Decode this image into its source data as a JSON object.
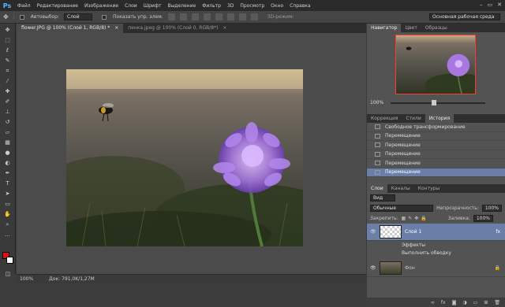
{
  "menu": {
    "logo": "Ps",
    "items": [
      "Файл",
      "Редактирование",
      "Изображение",
      "Слои",
      "Шрифт",
      "Выделение",
      "Фильтр",
      "3D",
      "Просмотр",
      "Окно",
      "Справка"
    ],
    "window_controls": [
      "–",
      "▭",
      "✕"
    ]
  },
  "options": {
    "autoselect_label": "Автовыбор:",
    "autoselect_value": "Слой",
    "show_transform_label": "Показать упр. элем.",
    "mode_3d": "3D-режим:",
    "workspace": "Основная рабочая среда"
  },
  "tabs": [
    {
      "label": "flower.JPG @ 100% (Слой 1, RGB/8) *",
      "close": "×"
    },
    {
      "label": "пенка.jpeg @ 100% (Слой 0, RGB/8*)",
      "close": "×"
    }
  ],
  "status": {
    "zoom": "100%",
    "doc": "Док: 791,0K/1,27M"
  },
  "navigator": {
    "tabs": [
      "Навигатор",
      "Цвет",
      "Образцы"
    ],
    "zoom": "100%"
  },
  "history": {
    "tabs": [
      "Коррекция",
      "Стили",
      "История"
    ],
    "rows": [
      "Свободное трансформирование",
      "Перемещение",
      "Перемещение",
      "Перемещение",
      "Перемещение",
      "Перемещение"
    ]
  },
  "layers": {
    "tabs": [
      "Слои",
      "Каналы",
      "Контуры"
    ],
    "kind": "Вид",
    "blend": "Обычные",
    "opacity_label": "Непрозрачность:",
    "opacity_value": "100%",
    "lock_label": "Закрепить:",
    "fill_label": "Заливка:",
    "fill_value": "100%",
    "items": [
      {
        "name": "Слой 1",
        "fx": "fx"
      },
      {
        "name": "Фон"
      }
    ],
    "effects_label": "Эффекты",
    "stroke_label": "Выполнить обводку",
    "footer_fx": "fx"
  },
  "colors": {
    "foreground": "#e01010",
    "background": "#ffffff"
  }
}
